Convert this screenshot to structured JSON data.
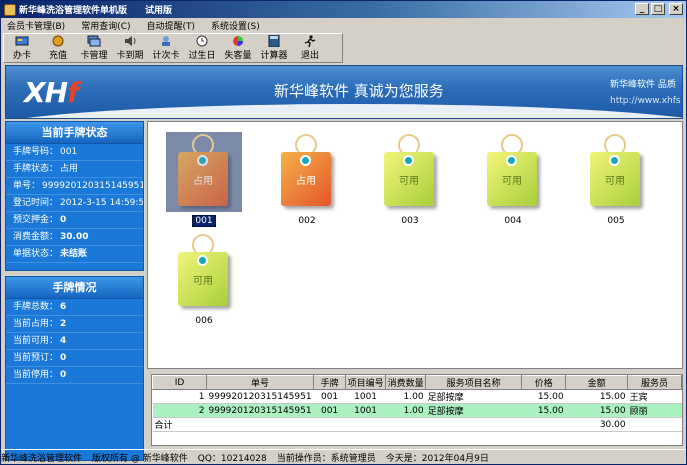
{
  "window": {
    "title": "新华峰洗浴管理软件单机版",
    "edition": "试用版",
    "min": "_",
    "max": "□",
    "close": "×"
  },
  "menu": [
    "会员卡管理(B)",
    "常用查询(C)",
    "自动提醒(T)",
    "系统设置(S)"
  ],
  "toolbar": [
    {
      "label": "办卡",
      "icon": "card-icon"
    },
    {
      "label": "充值",
      "icon": "money-icon"
    },
    {
      "label": "卡管理",
      "icon": "cards-icon"
    },
    {
      "label": "卡到期",
      "icon": "speaker-icon"
    },
    {
      "label": "计次卡",
      "icon": "gear-person-icon"
    },
    {
      "label": "过生日",
      "icon": "clock-icon"
    },
    {
      "label": "失客量",
      "icon": "color-wheel-icon"
    },
    {
      "label": "计算器",
      "icon": "calculator-icon"
    },
    {
      "label": "退出",
      "icon": "runner-icon"
    }
  ],
  "banner": {
    "logo_main": "XH",
    "logo_f": "f",
    "slogan": "新华峰软件 真诚为您服务",
    "brand": "新华峰软件 品质",
    "url": "http://www.xhfs"
  },
  "status_panel": {
    "title": "当前手牌状态",
    "rows": [
      {
        "label": "手牌号码：",
        "value": "001"
      },
      {
        "label": "手牌状态：",
        "value": "占用"
      },
      {
        "label": "单号：",
        "value": "999920120315145951"
      },
      {
        "label": "登记时间：",
        "value": "2012-3-15 14:59:51"
      },
      {
        "label": "预交押金：",
        "value": "0"
      },
      {
        "label": "消费金额：",
        "value": "30.00"
      },
      {
        "label": "单据状态：",
        "value": "未结账"
      }
    ]
  },
  "summary_panel": {
    "title": "手牌情况",
    "rows": [
      {
        "label": "手牌总数：",
        "value": "6"
      },
      {
        "label": "当前占用：",
        "value": "2"
      },
      {
        "label": "当前可用：",
        "value": "4"
      },
      {
        "label": "当前预订：",
        "value": "0"
      },
      {
        "label": "当前停用：",
        "value": "0"
      }
    ]
  },
  "tiles": [
    {
      "number": "001",
      "status": "占用"
    },
    {
      "number": "002",
      "status": "占用"
    },
    {
      "number": "003",
      "status": "可用"
    },
    {
      "number": "004",
      "status": "可用"
    },
    {
      "number": "005",
      "status": "可用"
    },
    {
      "number": "006",
      "status": "可用"
    }
  ],
  "table": {
    "headers": [
      "ID",
      "单号",
      "手牌",
      "项目编号",
      "消费数量",
      "服务项目名称",
      "价格",
      "金额",
      "服务员"
    ],
    "rows": [
      [
        "1",
        "999920120315145951",
        "001",
        "1001",
        "1.00",
        "足部按摩",
        "15.00",
        "15.00",
        "王宾"
      ],
      [
        "2",
        "999920120315145951",
        "001",
        "1001",
        "1.00",
        "足部按摩",
        "15.00",
        "15.00",
        "顾丽"
      ]
    ],
    "total_label": "合计",
    "total_value": "30.00"
  },
  "statusbar": {
    "app": "新华峰洗浴管理软件",
    "copyright": "版权所有 @ 新华峰软件",
    "qq": "QQ：10214028",
    "operator": "当前操作员：系统管理员",
    "today": "今天是：2012年04月9日"
  }
}
